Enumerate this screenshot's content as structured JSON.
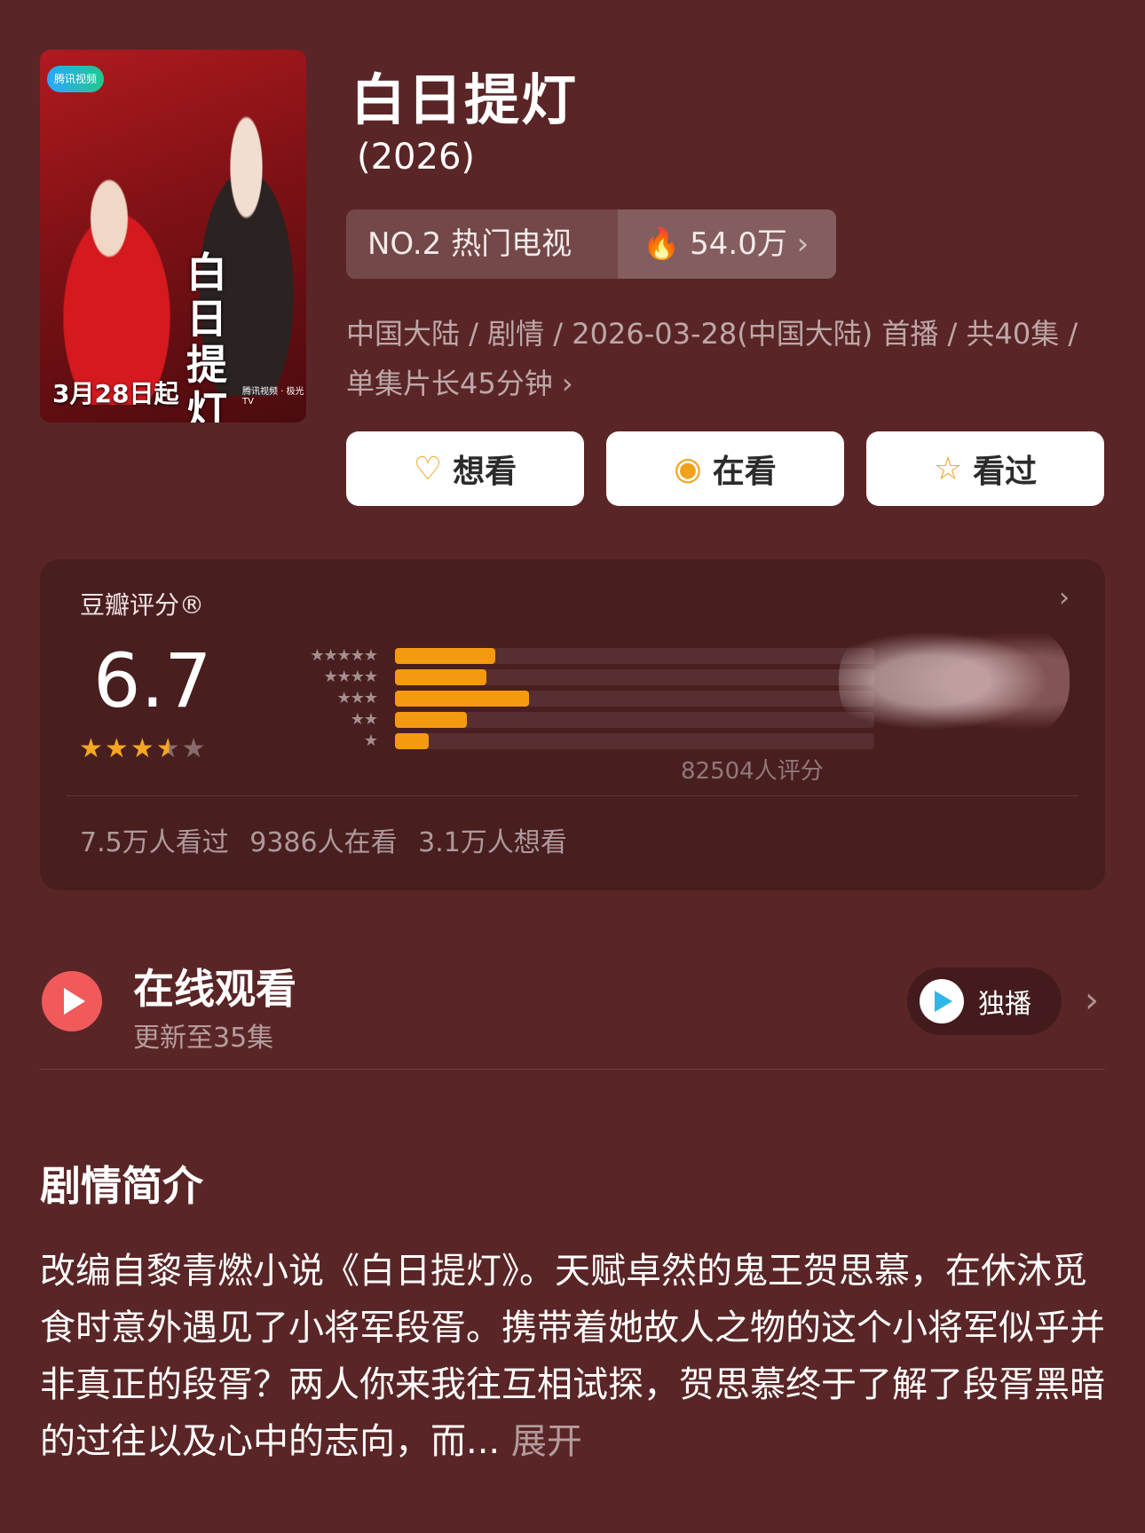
{
  "poster": {
    "logo_text": "腾讯视频",
    "calligraphy": "白日提灯",
    "release_text": "3月28日起",
    "platforms": "腾讯视频 · 极光TV"
  },
  "header": {
    "title": "白日提灯",
    "year": "(2026)"
  },
  "rank": {
    "label": "NO.2 热门电视",
    "heat": "54.0万",
    "heat_icon": "flame-icon"
  },
  "meta": {
    "line1": "中国大陆 / 剧情 / 2026-03-28(中国大陆) 首播 / 共40集 /",
    "line2": "单集片长45分钟 ›"
  },
  "actions": {
    "want": "想看",
    "watching": "在看",
    "watched": "看过"
  },
  "rating": {
    "title": "豆瓣评分®",
    "score": "6.7",
    "stars_filled": 3.5,
    "stars_total": 5,
    "distribution": [
      {
        "stars": "★★★★★",
        "fraction": 0.21
      },
      {
        "stars": "★★★★",
        "fraction": 0.19
      },
      {
        "stars": "★★★",
        "fraction": 0.28
      },
      {
        "stars": "★★",
        "fraction": 0.15
      },
      {
        "stars": "★",
        "fraction": 0.07
      }
    ],
    "count": "82504人评分",
    "stats": "7.5万人看过   9386人在看   3.1万人想看",
    "accent": "#f59a10"
  },
  "watch": {
    "title": "在线观看",
    "subtitle": "更新至35集",
    "platform_label": "独播"
  },
  "synopsis": {
    "title": "剧情简介",
    "text": "改编自黎青燃小说《白日提灯》。天赋卓然的鬼王贺思慕，在休沐觅食时意外遇见了小将军段胥。携带着她故人之物的这个小将军似乎并非真正的段胥？两人你来我往互相试探，贺思慕终于了解了段胥黑暗的过往以及心中的志向，而...",
    "more": "展开"
  }
}
